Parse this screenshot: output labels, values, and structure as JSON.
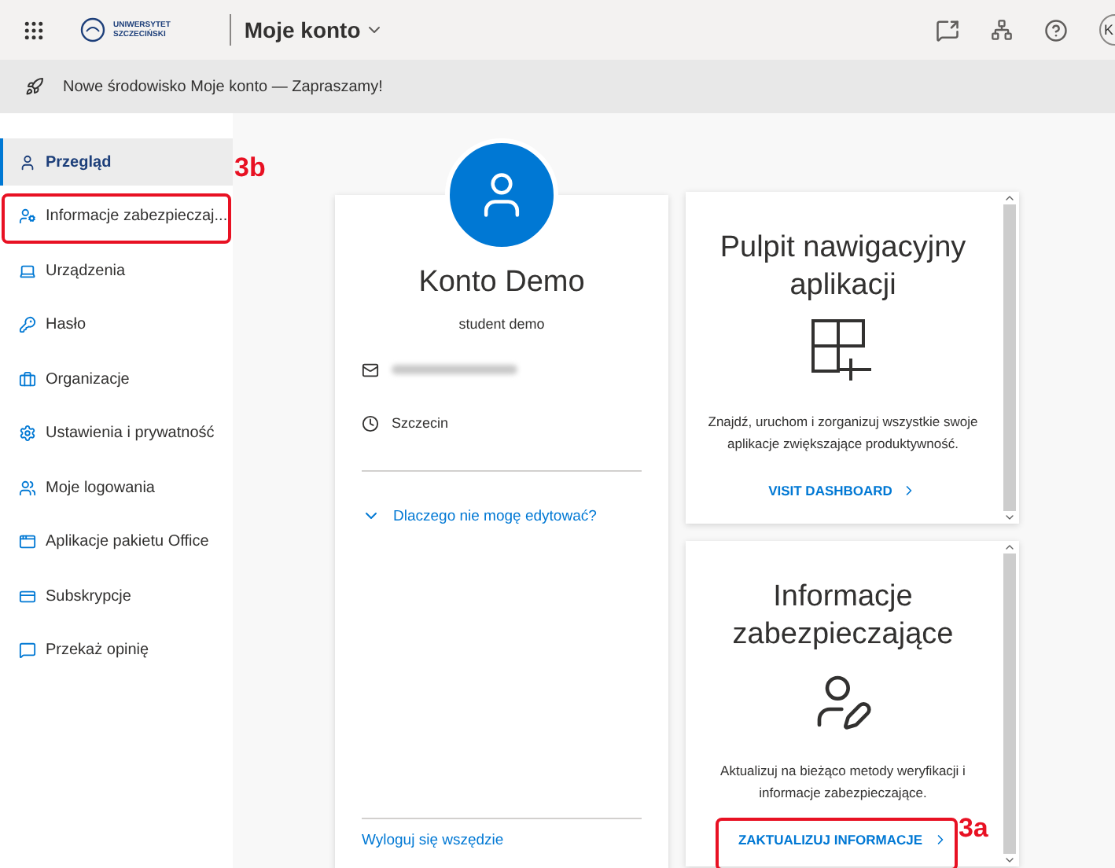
{
  "header": {
    "logo_lines": [
      "UNIWERSYTET",
      "SZCZECIŃSKI"
    ],
    "app_title": "Moje konto",
    "avatar_initials": "K"
  },
  "banner": {
    "text": "Nowe środowisko Moje konto — Zapraszamy!"
  },
  "sidebar": {
    "items": [
      {
        "label": "Przegląd",
        "selected": true
      },
      {
        "label": "Informacje zabezpieczaj...",
        "selected": false,
        "annotation": "3b"
      },
      {
        "label": "Urządzenia",
        "selected": false
      },
      {
        "label": "Hasło",
        "selected": false
      },
      {
        "label": "Organizacje",
        "selected": false
      },
      {
        "label": "Ustawienia i prywatność",
        "selected": false
      },
      {
        "label": "Moje logowania",
        "selected": false
      },
      {
        "label": "Aplikacje pakietu Office",
        "selected": false
      },
      {
        "label": "Subskrypcje",
        "selected": false
      },
      {
        "label": "Przekaż opinię",
        "selected": false
      }
    ]
  },
  "profile": {
    "name": "Konto Demo",
    "subtitle": "student demo",
    "location": "Szczecin",
    "edit_link": "Dlaczego nie mogę edytować?",
    "signout_link": "Wyloguj się wszędzie"
  },
  "cards": [
    {
      "title": "Pulpit nawigacyjny aplikacji",
      "description": "Znajdź, uruchom i zorganizuj wszystkie swoje aplikacje zwiększające produktywność.",
      "action": "VISIT DASHBOARD"
    },
    {
      "title": "Informacje zabezpieczające",
      "description": "Aktualizuj na bieżąco metody weryfikacji i informacje zabezpieczające.",
      "action": "ZAKTUALIZUJ INFORMACJE",
      "annotation": "3a"
    }
  ]
}
